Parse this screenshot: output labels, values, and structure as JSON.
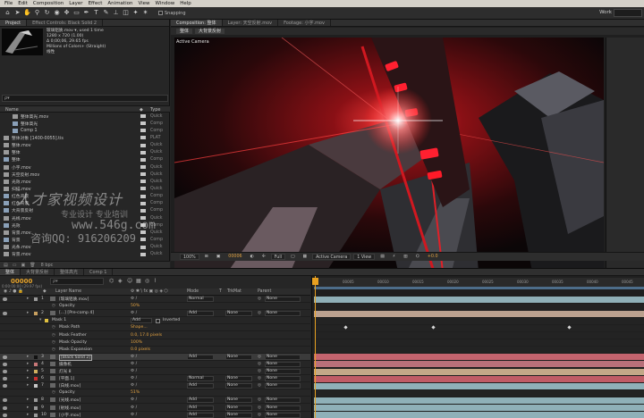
{
  "menu": [
    "File",
    "Edit",
    "Composition",
    "Layer",
    "Effect",
    "Animation",
    "View",
    "Window",
    "Help"
  ],
  "toolbar": {
    "snapping_label": "Snapping",
    "workspace": "Work"
  },
  "project_panel": {
    "tabs": [
      "Project",
      "Effect Controls: Black Solid 2"
    ],
    "info": [
      "玻璃铝质.mov ▾, used 1 time",
      "1280 x 720 (1.00)",
      "Δ 0;00;06, 29.65 fps",
      "Millions of Colors+ (Straight)",
      "线性"
    ],
    "search_placeholder": "ρ▾",
    "col_name": "Name",
    "col_type": "Type",
    "items": [
      {
        "name": "整体高光.mov",
        "type": "Quick",
        "indent": 1,
        "label": "#c8c8c8"
      },
      {
        "name": "整体高光",
        "type": "Comp",
        "indent": 1,
        "label": "#c8c8c8"
      },
      {
        "name": "Comp 1",
        "type": "Comp",
        "indent": 1,
        "label": "#c8c8c8"
      },
      {
        "name": "整体对象 [1400-0055].tis",
        "type": "PLAT",
        "indent": 0,
        "label": "#c8c8c8"
      },
      {
        "name": "整体.mov",
        "type": "Quick",
        "indent": 0,
        "label": "#c8c8c8"
      },
      {
        "name": "整体",
        "type": "Quick",
        "indent": 0,
        "label": "#c8c8c8"
      },
      {
        "name": "整体",
        "type": "Comp",
        "indent": 0,
        "label": "#c8c8c8"
      },
      {
        "name": "小字.mov",
        "type": "Quick",
        "indent": 0,
        "label": "#c8c8c8"
      },
      {
        "name": "天空反射.mov",
        "type": "Quick",
        "indent": 0,
        "label": "#c8c8c8"
      },
      {
        "name": "光效.mov",
        "type": "Quick",
        "indent": 0,
        "label": "#c8c8c8"
      },
      {
        "name": "扫描.mov",
        "type": "Quick",
        "indent": 0,
        "label": "#c8c8c8"
      },
      {
        "name": "红色背景",
        "type": "Comp",
        "indent": 0,
        "label": "#c8c8c8"
      },
      {
        "name": "红色背景",
        "type": "Comp",
        "indent": 0,
        "label": "#c8c8c8"
      },
      {
        "name": "大背景反射",
        "type": "Comp",
        "indent": 0,
        "label": "#c8c8c8"
      },
      {
        "name": "光线.mov",
        "type": "Quick",
        "indent": 0,
        "label": "#c8c8c8"
      },
      {
        "name": "光效",
        "type": "Comp",
        "indent": 0,
        "label": "#c8c8c8"
      },
      {
        "name": "背景.mov",
        "type": "Quick",
        "indent": 0,
        "label": "#c8c8c8"
      },
      {
        "name": "背景",
        "type": "Comp",
        "indent": 0,
        "label": "#c8c8c8"
      },
      {
        "name": "光条.mov",
        "type": "Quick",
        "indent": 0,
        "label": "#c8c8c8"
      },
      {
        "name": "背景.mov",
        "type": "Quick",
        "indent": 0,
        "label": "#c8c8c8"
      }
    ],
    "footer": "8 bpc"
  },
  "watermark": {
    "line1": "人才家视频设计",
    "line2": "专业设计  专业培训",
    "line3": "www.546g.com",
    "line4": "咨询QQ: 916206209"
  },
  "composition_panel": {
    "tabs": [
      "Composition: 整体",
      "Layer: 天空反射.mov",
      "Footage: 小字.mov"
    ],
    "breadcrumbs": [
      "整体",
      "大背景反射"
    ],
    "active_camera": "Active Camera",
    "footer": {
      "zoom": "100%",
      "timecode": "00006",
      "resolution": "Full",
      "camera": "Active Camera",
      "views": "1 View",
      "exposure": "+0.0"
    }
  },
  "timeline": {
    "tabs": [
      "整体",
      "大背景反射",
      "整体高光",
      "Comp 1"
    ],
    "timecode": "00000",
    "fps": "0:00:00:00 (29.97 fps)",
    "search_placeholder": "ρ▾",
    "columns": {
      "layer_name": "Layer Name",
      "mode": "Mode",
      "t": "T",
      "trkmat": "TrkMat",
      "parent": "Parent"
    },
    "ruler_ticks": [
      "00005",
      "00010",
      "00015",
      "00020",
      "00025",
      "00030",
      "00035",
      "00040",
      "00045"
    ],
    "rows": [
      {
        "num": "1",
        "name": "[玻璃铝质.mov]",
        "mode": "Normal",
        "trkmat": "",
        "parent": "None",
        "swatch": "#9a9a9a",
        "bar": "#8fb0b8"
      },
      {
        "num": "",
        "name": "Opacity",
        "value": "50%",
        "sub": true,
        "bar": "#232323"
      },
      {
        "num": "2",
        "name": "[...] [Pre-comp 4]",
        "mode": "Add",
        "trkmat": "None",
        "parent": "None",
        "swatch": "#c8a060",
        "bar": "#bba18f"
      },
      {
        "num": "",
        "name": "Mask 1",
        "mode": "Add",
        "extra": "Inverted",
        "sub": true,
        "mask": true,
        "bar": "#232323"
      },
      {
        "num": "",
        "name": "Mask Path",
        "value": "Shape...",
        "sub": true,
        "bar": "#232323"
      },
      {
        "num": "",
        "name": "Mask Feather",
        "value": "0.0, 17.0 pixels",
        "sub": true,
        "bar": "#232323"
      },
      {
        "num": "",
        "name": "Mask Opacity",
        "value": "100%",
        "sub": true,
        "bar": "#232323"
      },
      {
        "num": "",
        "name": "Mask Expansion",
        "value": "0.0 pixels",
        "sub": true,
        "bar": "#232323"
      },
      {
        "num": "3",
        "name": "[Black Solid 2]",
        "mode": "Add",
        "trkmat": "None",
        "parent": "None",
        "swatch": "#111111",
        "bar": "#c4646e",
        "selected": true
      },
      {
        "num": "4",
        "name": "摄像机",
        "mode": "",
        "trkmat": "",
        "parent": "None",
        "swatch": "#c87878",
        "bar": "#b8707a"
      },
      {
        "num": "5",
        "name": "灯光 8",
        "mode": "",
        "trkmat": "",
        "parent": "None",
        "swatch": "#d0b060",
        "bar": "#c3a888"
      },
      {
        "num": "6",
        "name": "[平面.1]",
        "mode": "Normal",
        "trkmat": "None",
        "parent": "None",
        "swatch": "#c83030",
        "bar": "#c05c66"
      },
      {
        "num": "7",
        "name": "[白线.mov]",
        "mode": "Add",
        "trkmat": "None",
        "parent": "None",
        "swatch": "#c8c8c8",
        "bar": "#8fb0b8"
      },
      {
        "num": "",
        "name": "Opacity",
        "value": "51%",
        "sub": true,
        "bar": "#232323"
      },
      {
        "num": "8",
        "name": "[光线.mov]",
        "mode": "Add",
        "trkmat": "None",
        "parent": "None",
        "swatch": "#9a9a9a",
        "bar": "#8fb0b8"
      },
      {
        "num": "9",
        "name": "[射线.mov]",
        "mode": "Add",
        "trkmat": "None",
        "parent": "None",
        "swatch": "#9a9a9a",
        "bar": "#8fb0b8"
      },
      {
        "num": "10",
        "name": "[小字.mov]",
        "mode": "Add",
        "trkmat": "None",
        "parent": "None",
        "swatch": "#9a9a9a",
        "bar": "#8fb0b8"
      }
    ]
  },
  "colors": {
    "accent": "#e8a020",
    "panel": "#262626",
    "menu": "#d4d0c8"
  }
}
